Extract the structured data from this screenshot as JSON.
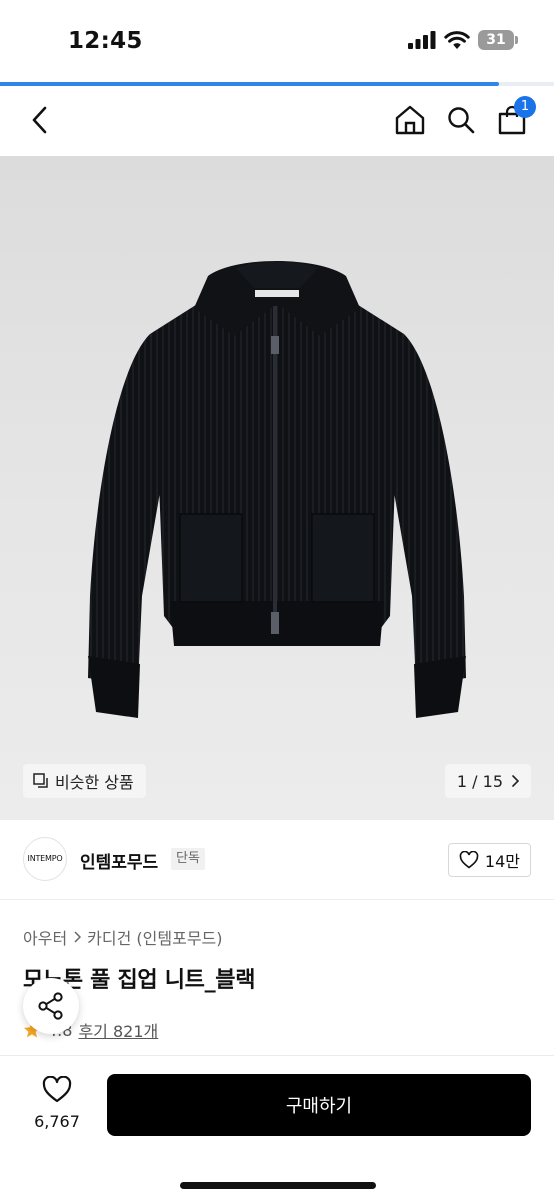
{
  "status_bar": {
    "time": "12:45",
    "battery": "31"
  },
  "page_progress": 0.9,
  "nav": {
    "cart_count": "1"
  },
  "gallery": {
    "similar_label": "비슷한 상품",
    "pager": "1 / 15"
  },
  "brand": {
    "logo_text": "INTEMPO",
    "name": "인템포무드",
    "badge": "단독",
    "likes": "14만"
  },
  "breadcrumb": {
    "category": "아우터",
    "subcategory": "카디건 (인템포무드)"
  },
  "product": {
    "title": "모노톤 풀 집업 니트_블랙",
    "rating": "4.8",
    "reviews": "후기 821개"
  },
  "bottom": {
    "wish_count": "6,767",
    "buy_label": "구매하기"
  },
  "colors": {
    "accent": "#2f86e8",
    "badge": "#1a73e8",
    "buy_button": "#000000"
  }
}
